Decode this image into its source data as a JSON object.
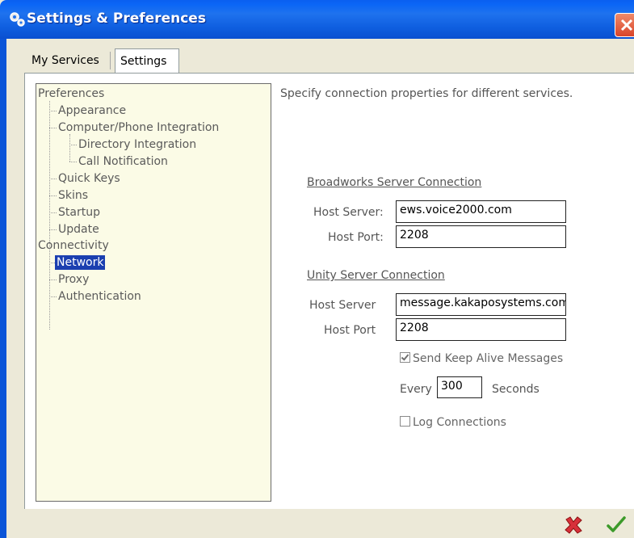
{
  "window": {
    "title": "Settings & Preferences",
    "icon": "gears-icon",
    "close_icon": "close-icon"
  },
  "tabs": [
    {
      "label": "My Services",
      "active": false
    },
    {
      "label": "Settings",
      "active": true
    }
  ],
  "tree": {
    "items": [
      {
        "label": "Preferences"
      },
      {
        "label": "Appearance"
      },
      {
        "label": "Computer/Phone Integration"
      },
      {
        "label": "Directory Integration"
      },
      {
        "label": "Call Notification"
      },
      {
        "label": "Quick Keys"
      },
      {
        "label": "Skins"
      },
      {
        "label": "Startup"
      },
      {
        "label": "Update"
      },
      {
        "label": "Connectivity"
      },
      {
        "label": "Network",
        "selected": true
      },
      {
        "label": "Proxy"
      },
      {
        "label": "Authentication"
      }
    ]
  },
  "content": {
    "description": "Specify connection properties for different services.",
    "broadworks": {
      "heading": "Broadworks Server Connection",
      "host_server_label": "Host Server:",
      "host_server_value": "ews.voice2000.com",
      "host_port_label": "Host Port:",
      "host_port_value": "2208"
    },
    "unity": {
      "heading": "Unity Server Connection",
      "host_server_label": "Host Server",
      "host_server_value": "message.kakaposystems.com",
      "host_port_label": "Host Port",
      "host_port_value": "2208"
    },
    "keep_alive": {
      "label": "Send Keep Alive Messages",
      "checked": true
    },
    "every": {
      "prefix": "Every",
      "value": "300",
      "suffix": "Seconds"
    },
    "log_connections": {
      "label": "Log Connections",
      "checked": false
    }
  },
  "footer": {
    "cancel_icon": "cancel-x-icon",
    "ok_icon": "ok-checkmark-icon"
  },
  "colors": {
    "titlebar": "#0b5fe8",
    "selection": "#1b3fb0",
    "tree_bg": "#fbfbe6",
    "cancel": "#d8303a",
    "ok": "#3c9a2a"
  }
}
